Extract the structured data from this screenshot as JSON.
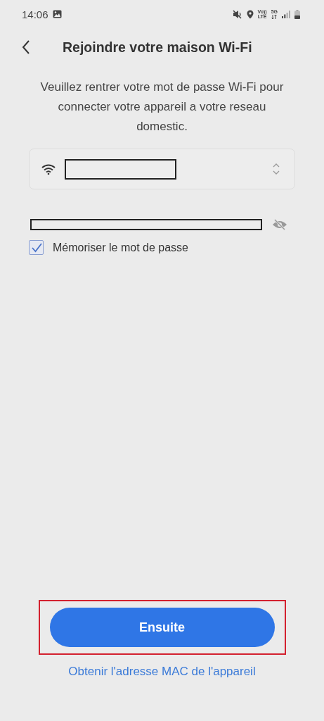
{
  "status_bar": {
    "time": "14:06",
    "volte_top": "Vo))",
    "volte_bottom": "LTE",
    "network": "5G"
  },
  "header": {
    "title": "Rejoindre votre maison Wi-Fi"
  },
  "instructions": "Veuillez rentrer votre mot de passe Wi-Fi pour connecter votre appareil a votre reseau domestic.",
  "remember_password": {
    "label": "Mémoriser le mot de passe",
    "checked": true
  },
  "primary_button": {
    "label": "Ensuite",
    "highlighted": true
  },
  "mac_link": "Obtenir l'adresse MAC de l'appareil"
}
